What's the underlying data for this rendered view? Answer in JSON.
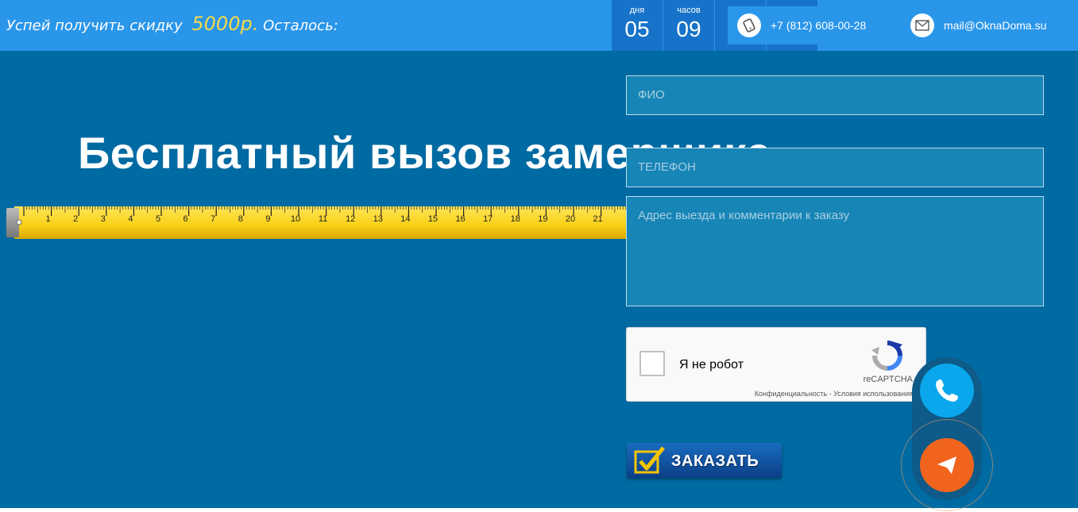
{
  "topbar": {
    "promo_text": "Успей получить скидку",
    "promo_amount": "5000р.",
    "promo_suffix": "Осталось:",
    "counters": [
      {
        "unit": "дня",
        "value": "05"
      },
      {
        "unit": "часов",
        "value": "09"
      }
    ],
    "phone": "+7 (812) 608-00-28",
    "email": "mail@OknaDoma.su"
  },
  "hero": {
    "headline": "Бесплатный вызов замерщика",
    "tape_marks": [
      "1",
      "2",
      "3",
      "4",
      "5",
      "6",
      "7",
      "8",
      "9",
      "10",
      "11",
      "12",
      "13",
      "14",
      "15",
      "16",
      "17",
      "18",
      "19",
      "20",
      "21"
    ]
  },
  "form": {
    "name_placeholder": "ФИО",
    "phone_placeholder": "ТЕЛЕФОН",
    "address_placeholder": "Адрес выезда и комментарии к заказу",
    "captcha_label": "Я не робот",
    "captcha_brand": "reCAPTCHA",
    "captcha_terms": "Конфиденциальность - Условия использования",
    "submit_label": "ЗАКАЗАТЬ"
  },
  "widget": {
    "call_icon": "phone-icon",
    "message_icon": "paper-plane-icon"
  },
  "colors": {
    "hero_bg": "#006aa2",
    "topbar_bg": "#2a96ea",
    "promo_amount": "#f5d94a",
    "call_button": "#0aa7ec",
    "message_button": "#f0641e"
  }
}
